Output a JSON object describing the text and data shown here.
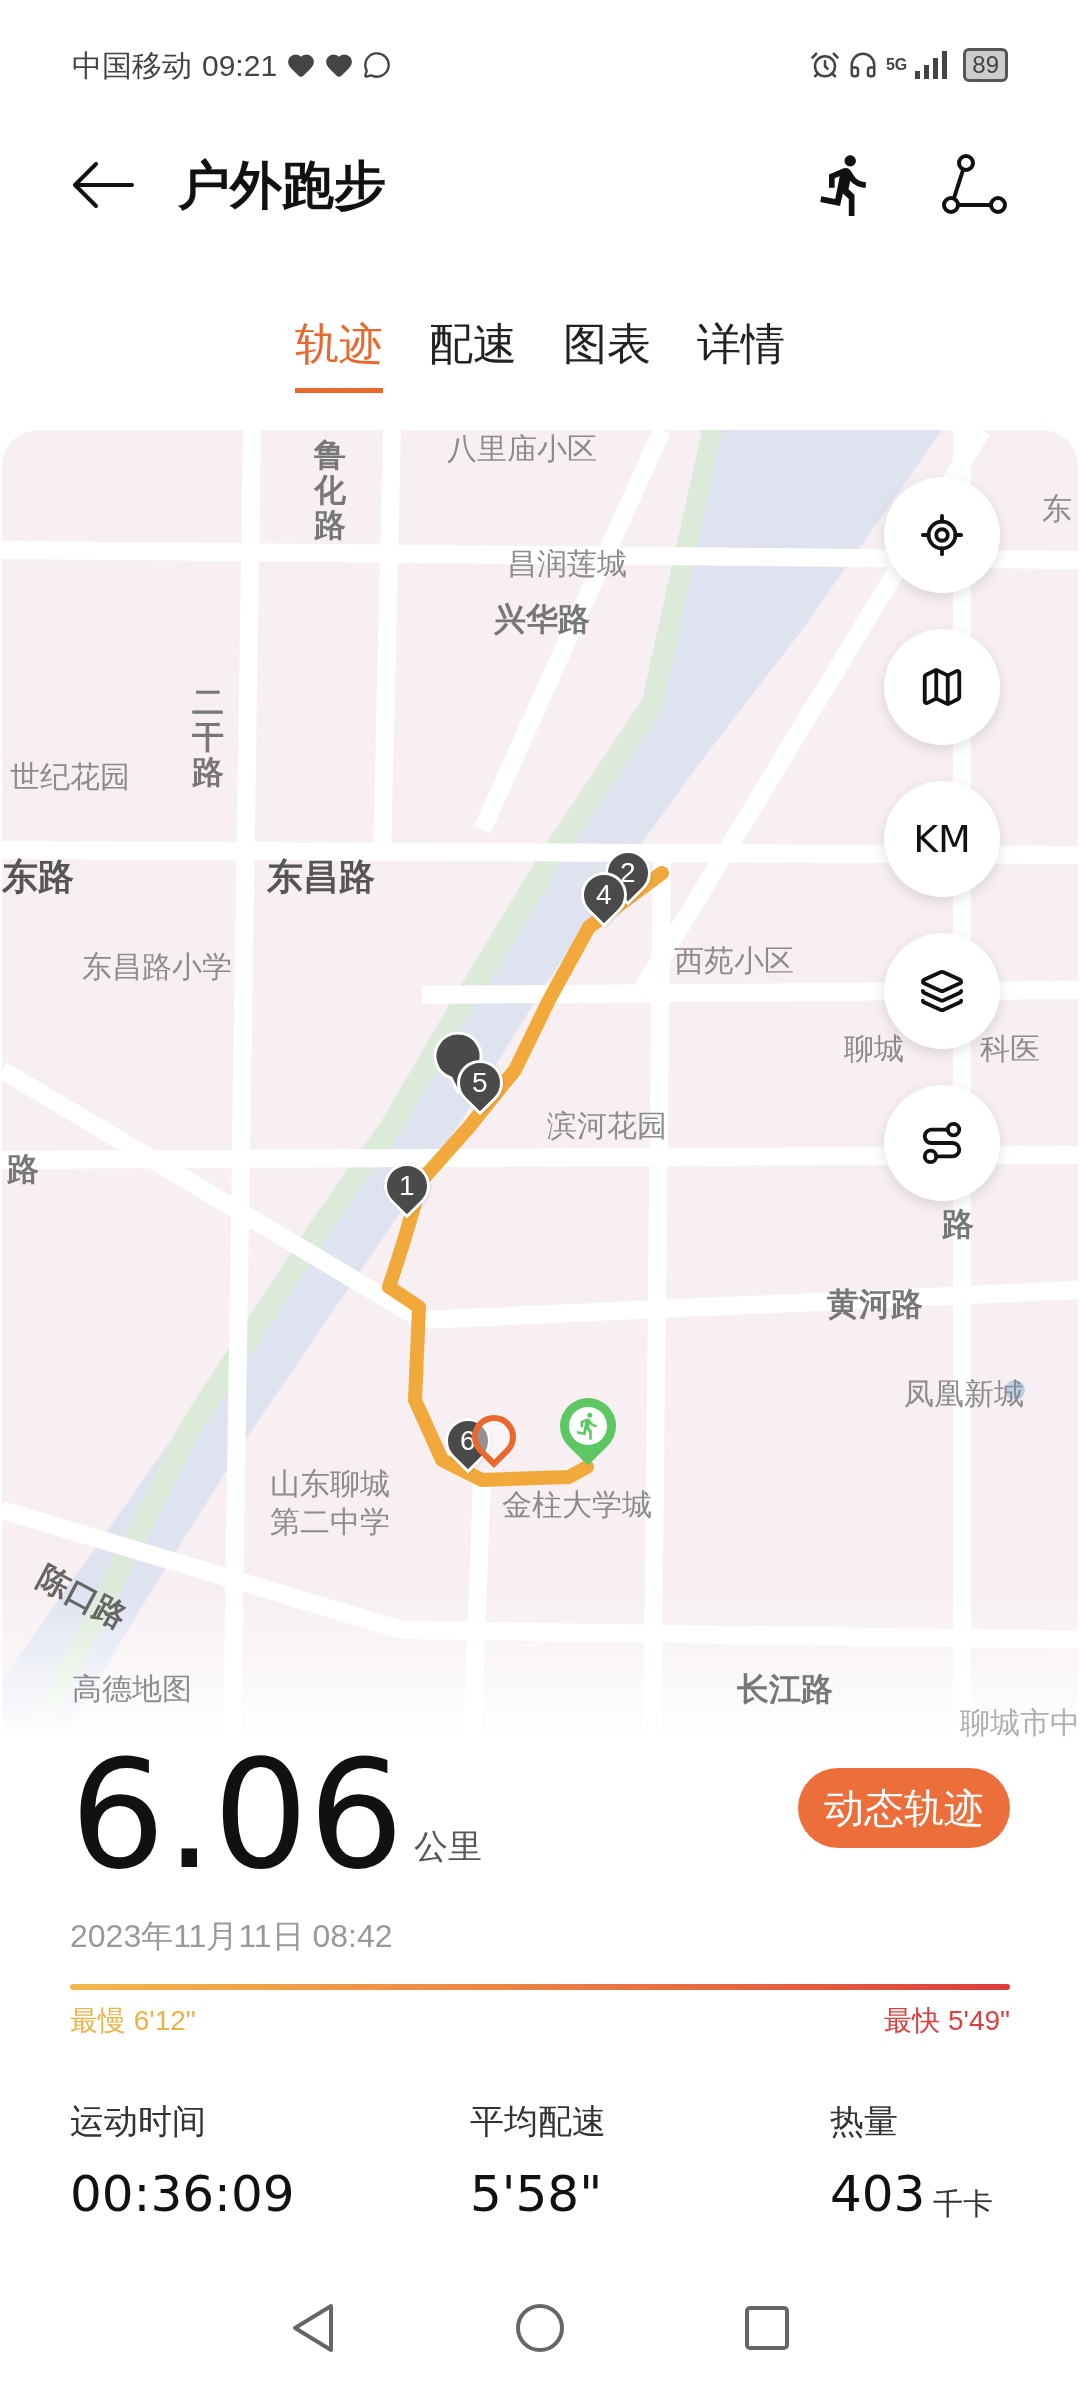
{
  "status_bar": {
    "carrier": "中国移动",
    "time": "09:21",
    "network": "5G",
    "battery": "89"
  },
  "header": {
    "title": "户外跑步"
  },
  "tabs": [
    {
      "label": "轨迹",
      "selected": true
    },
    {
      "label": "配速",
      "selected": false
    },
    {
      "label": "图表",
      "selected": false
    },
    {
      "label": "详情",
      "selected": false
    }
  ],
  "map": {
    "labels": [
      {
        "text": "鲁化路",
        "kind": "vertical"
      },
      {
        "text": "八里庙小区",
        "kind": "place"
      },
      {
        "text": "东",
        "kind": "place"
      },
      {
        "text": "昌润莲城",
        "kind": "place"
      },
      {
        "text": "兴华路",
        "kind": "road"
      },
      {
        "text": "世纪花园",
        "kind": "place"
      },
      {
        "text": "二干路",
        "kind": "vertical"
      },
      {
        "text": "东路",
        "kind": "major_road"
      },
      {
        "text": "东昌路",
        "kind": "major_road"
      },
      {
        "text": "东昌路小学",
        "kind": "place"
      },
      {
        "text": "西苑小区",
        "kind": "place"
      },
      {
        "text": "聊城",
        "kind": "place"
      },
      {
        "text": "科医",
        "kind": "place"
      },
      {
        "text": "滨河花园",
        "kind": "place"
      },
      {
        "text": "路",
        "kind": "road"
      },
      {
        "text": "路",
        "kind": "road"
      },
      {
        "text": "黄河路",
        "kind": "road"
      },
      {
        "text": "凤凰新城",
        "kind": "place"
      },
      {
        "text": "金柱大学城",
        "kind": "place"
      },
      {
        "text": "山东聊城第二中学",
        "kind": "block"
      },
      {
        "text": "陈口路",
        "kind": "rotated"
      },
      {
        "text": "高德地图",
        "kind": "place"
      },
      {
        "text": "长江路",
        "kind": "road"
      },
      {
        "text": "聊城市中",
        "kind": "faded"
      }
    ],
    "km_markers": [
      "5",
      "1",
      "2",
      "4",
      "6"
    ],
    "buttons": [
      {
        "kind": "locate"
      },
      {
        "kind": "map"
      },
      {
        "kind": "units",
        "label": "KM"
      },
      {
        "kind": "layers"
      },
      {
        "kind": "route"
      }
    ]
  },
  "summary": {
    "distance": "6.06",
    "unit": "公里",
    "replay_button": "动态轨迹",
    "date": "2023年11月11日 08:42",
    "slowest": "最慢 6'12\"",
    "fastest": "最快 5'49\""
  },
  "stats": [
    {
      "label": "运动时间",
      "value": "00:36:09"
    },
    {
      "label": "平均配速",
      "value": "5'58\""
    },
    {
      "label": "热量",
      "value": "403",
      "unit": "千卡"
    }
  ]
}
